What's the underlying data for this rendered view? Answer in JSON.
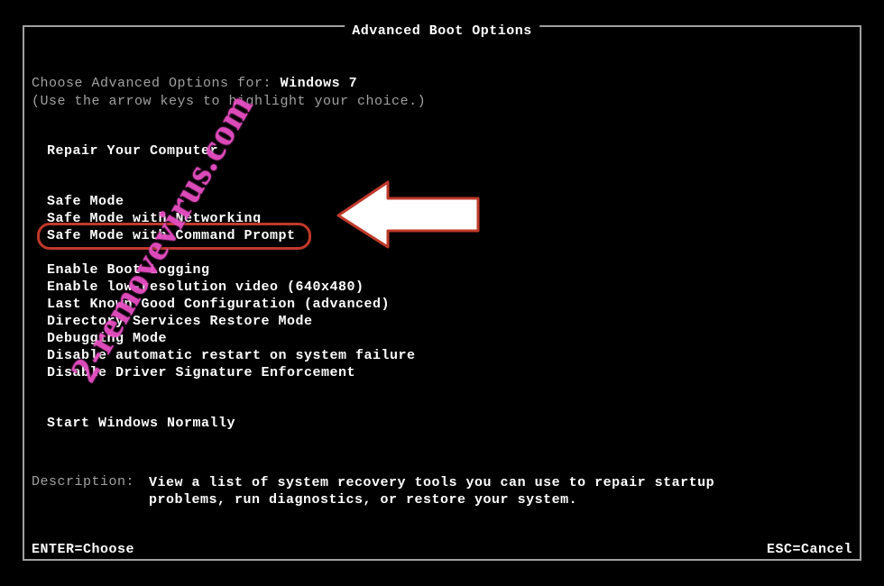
{
  "title": "Advanced Boot Options",
  "choose": {
    "prefix": "Choose Advanced Options for:",
    "os": "Windows 7",
    "hint": "(Use the arrow keys to highlight your choice.)"
  },
  "groups": {
    "g0": [
      "Repair Your Computer"
    ],
    "g1": [
      "Safe Mode",
      "Safe Mode with Networking",
      "Safe Mode with Command Prompt"
    ],
    "g2": [
      "Enable Boot Logging",
      "Enable low-resolution video (640x480)",
      "Last Known Good Configuration (advanced)",
      "Directory Services Restore Mode",
      "Debugging Mode",
      "Disable automatic restart on system failure",
      "Disable Driver Signature Enforcement"
    ],
    "g3": [
      "Start Windows Normally"
    ]
  },
  "description": {
    "label": "Description:",
    "text": "View a list of system recovery tools you can use to repair startup problems, run diagnostics, or restore your system."
  },
  "footer": {
    "left": "ENTER=Choose",
    "right": "ESC=Cancel"
  },
  "watermark_text": "2-removevirus.com",
  "highlighted_path": "groups.g1.2",
  "colors": {
    "accent_red": "#c0392b",
    "watermark_pink": "#e84fc3",
    "text_bright": "#ffffff",
    "text_dim": "#a0a0a0",
    "bg": "#000000"
  }
}
